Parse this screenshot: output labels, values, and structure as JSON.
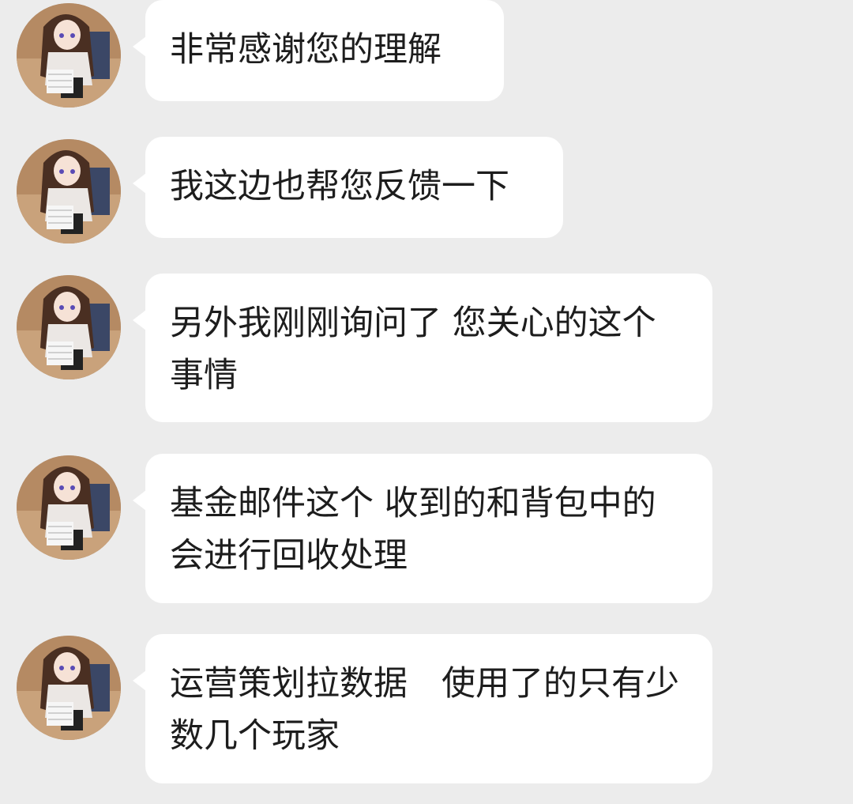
{
  "chat": {
    "messages": [
      {
        "sender_avatar": "anime-girl-avatar",
        "text": "非常感谢您的理解"
      },
      {
        "sender_avatar": "anime-girl-avatar",
        "text": "我这边也帮您反馈一下"
      },
      {
        "sender_avatar": "anime-girl-avatar",
        "text": "另外我刚刚询问了 您关心的这个事情"
      },
      {
        "sender_avatar": "anime-girl-avatar",
        "text": "基金邮件这个 收到的和背包中的会进行回收处理"
      },
      {
        "sender_avatar": "anime-girl-avatar",
        "text": "运营策划拉数据　使用了的只有少数几个玩家"
      }
    ]
  },
  "colors": {
    "background": "#ececec",
    "bubble": "#ffffff",
    "text": "#1d1d1d"
  }
}
